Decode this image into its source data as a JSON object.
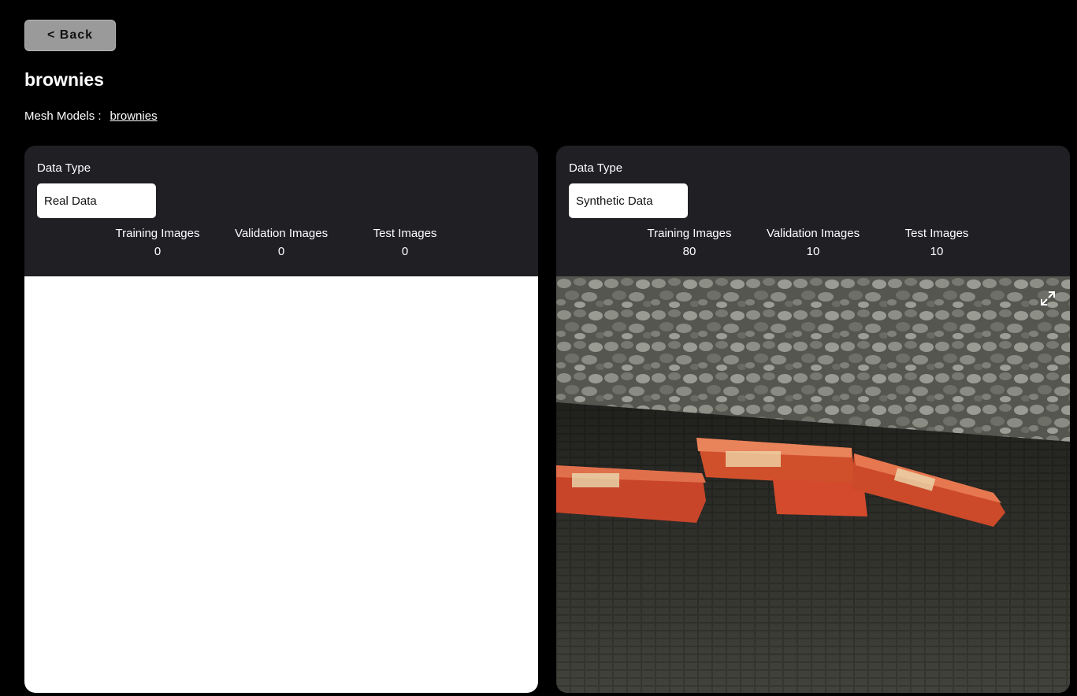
{
  "header": {
    "back_label": "< Back",
    "title": "brownies",
    "mesh_models_label": "Mesh Models :",
    "mesh_models": [
      "brownies"
    ]
  },
  "panels": [
    {
      "data_type_label": "Data Type",
      "data_type_value": "Real Data",
      "stats": [
        {
          "label": "Training Images",
          "value": "0"
        },
        {
          "label": "Validation Images",
          "value": "0"
        },
        {
          "label": "Test Images",
          "value": "0"
        }
      ]
    },
    {
      "data_type_label": "Data Type",
      "data_type_value": "Synthetic Data",
      "stats": [
        {
          "label": "Training Images",
          "value": "80"
        },
        {
          "label": "Validation Images",
          "value": "10"
        },
        {
          "label": "Test Images",
          "value": "10"
        }
      ],
      "preview_icon": "expand-icon"
    }
  ],
  "colors": {
    "background": "#000000",
    "panel": "#1f1f24",
    "back_button": "#9a9a9a"
  }
}
